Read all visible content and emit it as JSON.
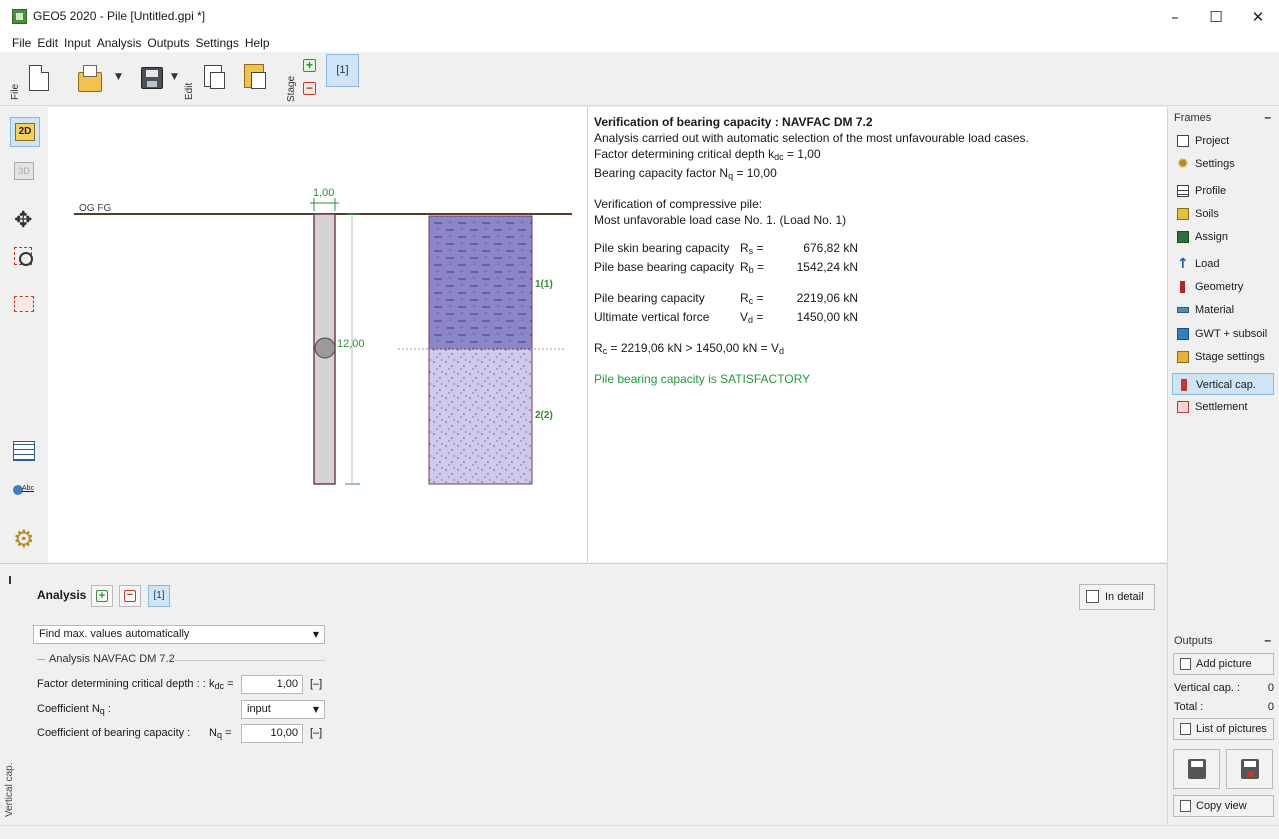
{
  "window": {
    "title": "GEO5 2020 - Pile [Untitled.gpi *]",
    "minimize_glyph": "–",
    "maximize_glyph": "☐",
    "close_glyph": "✕"
  },
  "menu": [
    "File",
    "Edit",
    "Input",
    "Analysis",
    "Outputs",
    "Settings",
    "Help"
  ],
  "toolbar": {
    "file_group": "File",
    "edit_group": "Edit",
    "stage_group": "Stage",
    "stage_current": "[1]"
  },
  "left_tools": {
    "view_2d": "2D",
    "view_3d": "3D"
  },
  "drawing": {
    "terrain_label": "OG FG",
    "pile_width": "1,00",
    "pile_length": "12,00",
    "layer_1": "1(1)",
    "layer_2": "2(2)",
    "colors": {
      "layer_1": "#8a86c8",
      "layer_2": "#cdcaea",
      "pile": "#d3d3d3",
      "dimension": "#2f8f2f",
      "terrain": "#5a3a2a"
    }
  },
  "results": {
    "title": "Verification of bearing capacity : NAVFAC DM 7.2",
    "line1": "Analysis carried out with automatic selection of the most unfavourable load cases.",
    "kdc_text": "Factor determining critical depth k",
    "kdc_sub": "dc",
    "kdc_value": " = 1,00",
    "nq_text": "Bearing capacity factor N",
    "nq_sub": "q",
    "nq_value": " = 10,00",
    "verif_title": "Verification of compressive pile:",
    "load_case": "Most unfavorable load case No. 1. (Load No. 1)",
    "rows": [
      {
        "label": "Pile skin bearing capacity",
        "sym": "R",
        "sub": "s",
        "value": "676,82",
        "unit": "kN"
      },
      {
        "label": "Pile base bearing capacity",
        "sym": "R",
        "sub": "b",
        "value": "1542,24",
        "unit": "kN"
      },
      {
        "label": "Pile bearing capacity",
        "sym": "R",
        "sub": "c",
        "value": "2219,06",
        "unit": "kN"
      },
      {
        "label": "Ultimate vertical force",
        "sym": "V",
        "sub": "d",
        "value": "1450,00",
        "unit": "kN"
      }
    ],
    "comparison_left": "R",
    "comparison_left_sub": "c",
    "comparison_mid": " = 2219,06 kN > 1450,00 kN = V",
    "comparison_right_sub": "d",
    "verdict": "Pile bearing capacity is SATISFACTORY"
  },
  "frames": {
    "header": "Frames",
    "items": [
      "Project",
      "Settings",
      "Profile",
      "Soils",
      "Assign",
      "Load",
      "Geometry",
      "Material",
      "GWT + subsoil",
      "Stage settings",
      "Vertical cap.",
      "Settlement"
    ],
    "active": "Vertical cap."
  },
  "analysis": {
    "label": "Analysis :",
    "current": "[1]",
    "in_detail": "In detail",
    "mode_select": "Find max. values automatically",
    "group_title": "Analysis NAVFAC DM 7.2",
    "kdc_label": "Factor determining critical depth : :",
    "kdc_sym": "k",
    "kdc_sub": "dc",
    "kdc_eq": " =",
    "kdc_value": "1,00",
    "kdc_unit": "[–]",
    "nq_coef_label": "Coefficient N",
    "nq_coef_sub": "q",
    "nq_coef_colon": " :",
    "nq_coef_select": "input",
    "nq_label": "Coefficient of bearing capacity :",
    "nq_sym": "N",
    "nq_sub": "q",
    "nq_eq": " =",
    "nq_value": "10,00",
    "nq_unit": "[–]",
    "side_label": "Vertical cap."
  },
  "outputs": {
    "header": "Outputs",
    "add_picture": "Add picture",
    "vertical_cap_label": "Vertical cap. :",
    "vertical_cap_count": "0",
    "total_label": "Total :",
    "total_count": "0",
    "list_pictures": "List of pictures",
    "copy_view": "Copy view"
  }
}
